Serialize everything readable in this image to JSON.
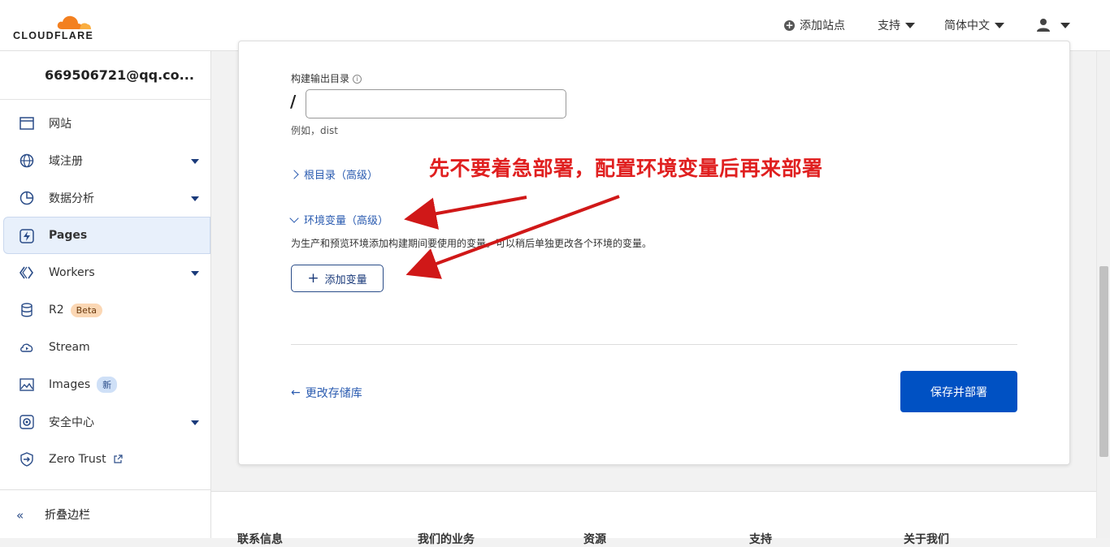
{
  "header": {
    "logo_text": "CLOUDFLARE",
    "add_site": "添加站点",
    "support": "支持",
    "language": "简体中文"
  },
  "sidebar": {
    "account": "669506721@qq.co...",
    "items": [
      {
        "label": "网站",
        "icon": "browser-window-icon"
      },
      {
        "label": "域注册",
        "icon": "globe-icon"
      },
      {
        "label": "数据分析",
        "icon": "pie-chart-icon"
      },
      {
        "label": "Pages",
        "icon": "lightning-icon"
      },
      {
        "label": "Workers",
        "icon": "workers-icon"
      },
      {
        "label": "R2",
        "icon": "database-icon",
        "badge": "Beta"
      },
      {
        "label": "Stream",
        "icon": "cloud-play-icon"
      },
      {
        "label": "Images",
        "icon": "image-icon",
        "badge": "新"
      },
      {
        "label": "安全中心",
        "icon": "shield-gear-icon"
      },
      {
        "label": "Zero Trust",
        "icon": "zero-trust-icon"
      }
    ],
    "collapse": "折叠边栏"
  },
  "form": {
    "output_dir_label": "构建输出目录",
    "slash": "/",
    "output_dir_value": "",
    "output_dir_hint": "例如，dist",
    "root_dir_toggle": "根目录（高级）",
    "env_vars_toggle": "环境变量（高级）",
    "env_vars_description": "为生产和预览环境添加构建期间要使用的变量。可以稍后单独更改各个环境的变量。",
    "add_variable": "添加变量",
    "change_repo": "更改存储库",
    "save_deploy": "保存并部署"
  },
  "annotation": {
    "text": "先不要着急部署，配置环境变量后再来部署",
    "color": "#e02020"
  },
  "footer": {
    "columns": [
      "联系信息",
      "我们的业务",
      "资源",
      "支持",
      "关于我们"
    ]
  },
  "colors": {
    "brand_orange": "#f38020",
    "primary_button": "#0051c3",
    "link": "#2a5bb0"
  }
}
